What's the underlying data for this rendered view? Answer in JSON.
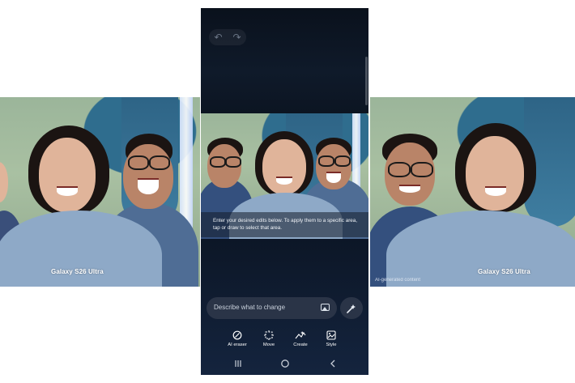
{
  "left_photo": {
    "camera_label": "Galaxy S26 Ultra"
  },
  "right_photo": {
    "camera_label": "Galaxy S26 Ultra",
    "ai_note": "AI-generated content"
  },
  "phone": {
    "hint_text": "Enter your desired edits below. To apply them to a specific area, tap or draw to select that area.",
    "prompt_placeholder": "Describe what to change",
    "tools": [
      {
        "label": "AI eraser",
        "icon": "eraser-icon"
      },
      {
        "label": "Move",
        "icon": "move-icon"
      },
      {
        "label": "Create",
        "icon": "create-icon"
      },
      {
        "label": "Style",
        "icon": "style-icon"
      }
    ]
  },
  "colors": {
    "phone_background": "#0c1626",
    "prompt_bar": "#2a3447",
    "wall_green": "#9bb59a",
    "wall_blue": "#2f6d8e"
  }
}
